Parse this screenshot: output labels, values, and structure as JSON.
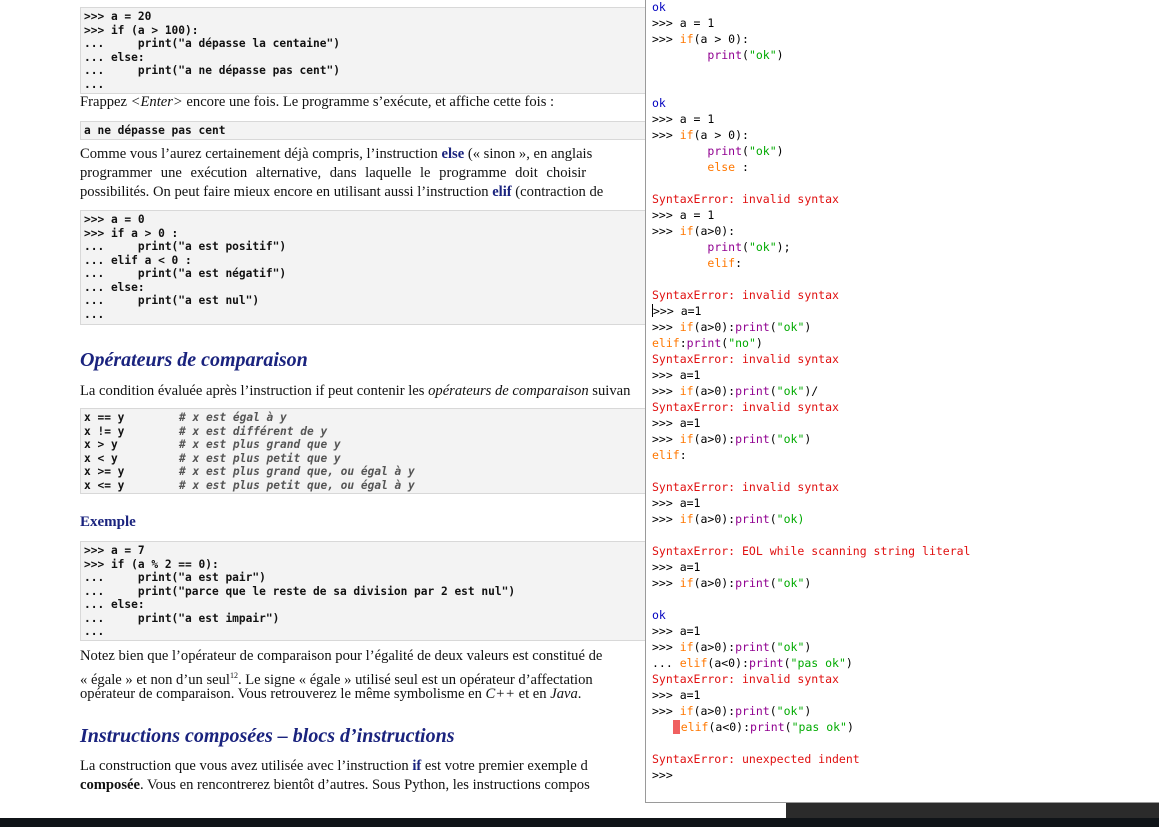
{
  "document": {
    "code1": [
      ">>> a = 20",
      ">>> if (a > 100):",
      "...     print(\"a dépasse la centaine\")",
      "... else:",
      "...     print(\"a ne dépasse pas cent\")",
      "..."
    ],
    "p1_a": "Frappez ",
    "p1_enter": "<Enter>",
    "p1_b": " encore une fois. Le programme s’exécute, et affiche cette fois :",
    "output1": "a ne dépasse pas cent",
    "p2_l1_a": "Comme vous l’aurez certainement déjà compris, l’instruction ",
    "p2_l1_kw": "else",
    "p2_l1_b": " (« sinon », en anglais",
    "p2_l2": "programmer une exécution alternative, dans laquelle le programme doit choisir",
    "p2_l3_a": "possibilités. On peut faire mieux encore en utilisant aussi l’instruction ",
    "p2_l3_kw": "elif",
    "p2_l3_b": " (contraction de",
    "code2": [
      ">>> a = 0",
      ">>> if a > 0 :",
      "...     print(\"a est positif\")",
      "... elif a < 0 :",
      "...     print(\"a est négatif\")",
      "... else:",
      "...     print(\"a est nul\")",
      "..."
    ],
    "heading1": "Opérateurs de comparaison",
    "p3_a": "La condition évaluée après l’instruction if peut contenir les ",
    "p3_em": "opérateurs de comparaison",
    "p3_b": " suivan",
    "ops": [
      {
        "code": "x == y",
        "comment": "# x est égal à y"
      },
      {
        "code": "x != y",
        "comment": "# x est différent de y"
      },
      {
        "code": "x > y",
        "comment": "# x est plus grand que y"
      },
      {
        "code": "x < y",
        "comment": "# x est plus petit que y"
      },
      {
        "code": "x >= y",
        "comment": "# x est plus grand que, ou égal à y"
      },
      {
        "code": "x <= y",
        "comment": "# x est plus petit que, ou égal à y"
      }
    ],
    "heading2": "Exemple",
    "code3": [
      ">>> a = 7",
      ">>> if (a % 2 == 0):",
      "...     print(\"a est pair\")",
      "...     print(\"parce que le reste de sa division par 2 est nul\")",
      "... else:",
      "...     print(\"a est impair\")",
      "..."
    ],
    "p4_l1": "Notez bien que l’opérateur de comparaison pour l’égalité de deux valeurs est constitué de",
    "p4_l2_a": "« égale » et non d’un seul",
    "p4_l2_sup": "12",
    "p4_l2_b": ". Le signe « égale » utilisé seul est un opérateur d’affectation",
    "p4_l3_a": "opérateur de comparaison. Vous retrouverez le même symbolisme en ",
    "p4_l3_em1": "C++",
    "p4_l3_b": " et en ",
    "p4_l3_em2": "Java",
    "p4_l3_c": ".",
    "heading3": "Instructions composées – blocs d’instructions",
    "p5_l1_a": "La construction que vous avez utilisée avec l’instruction ",
    "p5_l1_kw": "if",
    "p5_l1_b": " est votre premier exemple d",
    "p5_l2_kw": "composée",
    "p5_l2_b": ". Vous en rencontrerez bientôt d’autres. Sous Python, les instructions compos"
  },
  "shell": {
    "lines": [
      {
        "type": "out",
        "segs": [
          {
            "t": "ok"
          }
        ]
      },
      {
        "type": "in",
        "segs": [
          {
            "t": ">>> a = 1"
          }
        ]
      },
      {
        "type": "in",
        "segs": [
          {
            "t": ">>> "
          },
          {
            "t": "if",
            "c": "kw"
          },
          {
            "t": "(a > 0):"
          }
        ]
      },
      {
        "type": "in",
        "segs": [
          {
            "t": "        "
          },
          {
            "t": "print",
            "c": "bi"
          },
          {
            "t": "("
          },
          {
            "t": "\"ok\"",
            "c": "st"
          },
          {
            "t": ")"
          }
        ]
      },
      {
        "type": "in",
        "segs": []
      },
      {
        "type": "in",
        "segs": []
      },
      {
        "type": "out",
        "segs": [
          {
            "t": "ok"
          }
        ]
      },
      {
        "type": "in",
        "segs": [
          {
            "t": ">>> a = 1"
          }
        ]
      },
      {
        "type": "in",
        "segs": [
          {
            "t": ">>> "
          },
          {
            "t": "if",
            "c": "kw"
          },
          {
            "t": "(a > 0):"
          }
        ]
      },
      {
        "type": "in",
        "segs": [
          {
            "t": "        "
          },
          {
            "t": "print",
            "c": "bi"
          },
          {
            "t": "("
          },
          {
            "t": "\"ok\"",
            "c": "st"
          },
          {
            "t": ")"
          }
        ]
      },
      {
        "type": "in",
        "segs": [
          {
            "t": "        "
          },
          {
            "t": "else",
            "c": "kw"
          },
          {
            "t": " :"
          }
        ]
      },
      {
        "type": "in",
        "segs": []
      },
      {
        "type": "err",
        "segs": [
          {
            "t": "SyntaxError: invalid syntax"
          }
        ]
      },
      {
        "type": "in",
        "segs": [
          {
            "t": ">>> a = 1"
          }
        ]
      },
      {
        "type": "in",
        "segs": [
          {
            "t": ">>> "
          },
          {
            "t": "if",
            "c": "kw"
          },
          {
            "t": "(a>0):"
          }
        ]
      },
      {
        "type": "in",
        "segs": [
          {
            "t": "        "
          },
          {
            "t": "print",
            "c": "bi"
          },
          {
            "t": "("
          },
          {
            "t": "\"ok\"",
            "c": "st"
          },
          {
            "t": ");"
          }
        ]
      },
      {
        "type": "in",
        "segs": [
          {
            "t": "        "
          },
          {
            "t": "elif",
            "c": "kw"
          },
          {
            "t": ":"
          }
        ]
      },
      {
        "type": "in",
        "segs": []
      },
      {
        "type": "err",
        "segs": [
          {
            "t": "SyntaxError: invalid syntax"
          }
        ]
      },
      {
        "type": "in",
        "caret": true,
        "segs": [
          {
            "t": ">>> a=1"
          }
        ]
      },
      {
        "type": "in",
        "segs": [
          {
            "t": ">>> "
          },
          {
            "t": "if",
            "c": "kw"
          },
          {
            "t": "(a>0):"
          },
          {
            "t": "print",
            "c": "bi"
          },
          {
            "t": "("
          },
          {
            "t": "\"ok\"",
            "c": "st"
          },
          {
            "t": ")"
          }
        ]
      },
      {
        "type": "in",
        "segs": [
          {
            "t": "elif",
            "c": "kw"
          },
          {
            "t": ":"
          },
          {
            "t": "print",
            "c": "bi"
          },
          {
            "t": "("
          },
          {
            "t": "\"no\"",
            "c": "st"
          },
          {
            "t": ")"
          }
        ]
      },
      {
        "type": "err",
        "segs": [
          {
            "t": "SyntaxError: invalid syntax"
          }
        ]
      },
      {
        "type": "in",
        "segs": [
          {
            "t": ">>> a=1"
          }
        ]
      },
      {
        "type": "in",
        "segs": [
          {
            "t": ">>> "
          },
          {
            "t": "if",
            "c": "kw"
          },
          {
            "t": "(a>0):"
          },
          {
            "t": "print",
            "c": "bi"
          },
          {
            "t": "("
          },
          {
            "t": "\"ok\"",
            "c": "st"
          },
          {
            "t": ")/"
          }
        ]
      },
      {
        "type": "err",
        "segs": [
          {
            "t": "SyntaxError: invalid syntax"
          }
        ]
      },
      {
        "type": "in",
        "segs": [
          {
            "t": ">>> a=1"
          }
        ]
      },
      {
        "type": "in",
        "segs": [
          {
            "t": ">>> "
          },
          {
            "t": "if",
            "c": "kw"
          },
          {
            "t": "(a>0):"
          },
          {
            "t": "print",
            "c": "bi"
          },
          {
            "t": "("
          },
          {
            "t": "\"ok\"",
            "c": "st"
          },
          {
            "t": ")"
          }
        ]
      },
      {
        "type": "in",
        "segs": [
          {
            "t": "elif",
            "c": "kw"
          },
          {
            "t": ":"
          }
        ]
      },
      {
        "type": "in",
        "segs": []
      },
      {
        "type": "err",
        "segs": [
          {
            "t": "SyntaxError: invalid syntax"
          }
        ]
      },
      {
        "type": "in",
        "segs": [
          {
            "t": ">>> a=1"
          }
        ]
      },
      {
        "type": "in",
        "segs": [
          {
            "t": ">>> "
          },
          {
            "t": "if",
            "c": "kw"
          },
          {
            "t": "(a>0):"
          },
          {
            "t": "print",
            "c": "bi"
          },
          {
            "t": "("
          },
          {
            "t": "\"ok)",
            "c": "st"
          }
        ]
      },
      {
        "type": "in",
        "segs": []
      },
      {
        "type": "err",
        "segs": [
          {
            "t": "SyntaxError: EOL while scanning string literal"
          }
        ]
      },
      {
        "type": "in",
        "segs": [
          {
            "t": ">>> a=1"
          }
        ]
      },
      {
        "type": "in",
        "segs": [
          {
            "t": ">>> "
          },
          {
            "t": "if",
            "c": "kw"
          },
          {
            "t": "(a>0):"
          },
          {
            "t": "print",
            "c": "bi"
          },
          {
            "t": "("
          },
          {
            "t": "\"ok\"",
            "c": "st"
          },
          {
            "t": ")"
          }
        ]
      },
      {
        "type": "in",
        "segs": []
      },
      {
        "type": "out",
        "segs": [
          {
            "t": "ok"
          }
        ]
      },
      {
        "type": "in",
        "segs": [
          {
            "t": ">>> a=1"
          }
        ]
      },
      {
        "type": "in",
        "segs": [
          {
            "t": ">>> "
          },
          {
            "t": "if",
            "c": "kw"
          },
          {
            "t": "(a>0):"
          },
          {
            "t": "print",
            "c": "bi"
          },
          {
            "t": "("
          },
          {
            "t": "\"ok\"",
            "c": "st"
          },
          {
            "t": ")"
          }
        ]
      },
      {
        "type": "in",
        "segs": [
          {
            "t": "... "
          },
          {
            "t": "elif",
            "c": "kw"
          },
          {
            "t": "(a<0):"
          },
          {
            "t": "print",
            "c": "bi"
          },
          {
            "t": "("
          },
          {
            "t": "\"pas ok\"",
            "c": "st"
          },
          {
            "t": ")"
          }
        ]
      },
      {
        "type": "err",
        "segs": [
          {
            "t": "SyntaxError: invalid syntax"
          }
        ]
      },
      {
        "type": "in",
        "segs": [
          {
            "t": ">>> a=1"
          }
        ]
      },
      {
        "type": "in",
        "segs": [
          {
            "t": ">>> "
          },
          {
            "t": "if",
            "c": "kw"
          },
          {
            "t": "(a>0):"
          },
          {
            "t": "print",
            "c": "bi"
          },
          {
            "t": "("
          },
          {
            "t": "\"ok\"",
            "c": "st"
          },
          {
            "t": ")"
          }
        ]
      },
      {
        "type": "in",
        "redblock": true,
        "segs": [
          {
            "t": "elif",
            "c": "kw"
          },
          {
            "t": "(a<0):"
          },
          {
            "t": "print",
            "c": "bi"
          },
          {
            "t": "("
          },
          {
            "t": "\"pas ok\"",
            "c": "st"
          },
          {
            "t": ")"
          }
        ]
      },
      {
        "type": "in",
        "segs": []
      },
      {
        "type": "err",
        "segs": [
          {
            "t": "SyntaxError: unexpected indent"
          }
        ]
      },
      {
        "type": "in",
        "segs": [
          {
            "t": ">>>"
          }
        ]
      }
    ]
  }
}
